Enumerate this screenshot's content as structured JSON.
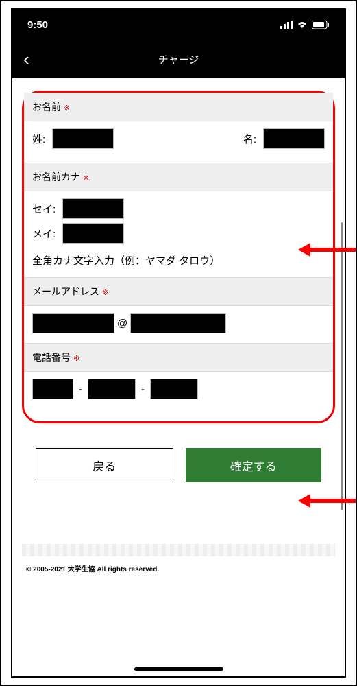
{
  "status": {
    "time": "9:50"
  },
  "nav": {
    "title": "チャージ"
  },
  "form": {
    "name": {
      "header": "お名前",
      "lastLabel": "姓:",
      "firstLabel": "名:"
    },
    "nameKana": {
      "header": "お名前カナ",
      "seiLabel": "セイ:",
      "meiLabel": "メイ:",
      "hint": "全角カナ文字入力（例：ヤマダ タロウ）"
    },
    "email": {
      "header": "メールアドレス",
      "at": "@"
    },
    "tel": {
      "header": "電話番号",
      "sep": "-"
    }
  },
  "buttons": {
    "back": "戻る",
    "confirm": "確定する"
  },
  "footer": {
    "copyright": "© 2005-2021 大学生協 All rights reserved."
  }
}
